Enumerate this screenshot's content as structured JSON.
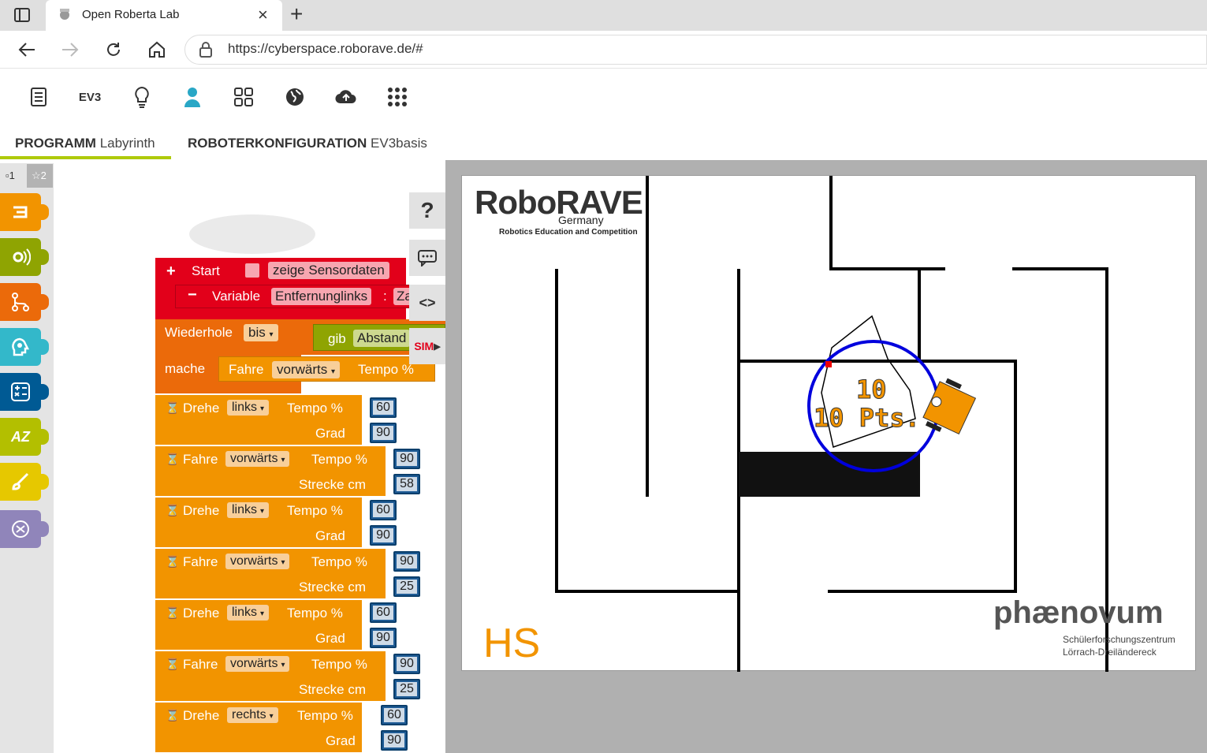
{
  "browser": {
    "tab_title": "Open Roberta Lab",
    "url": "https://cyberspace.roborave.de/#",
    "new_tab_symbol": "+",
    "close_symbol": "×"
  },
  "menubar": {
    "items": [
      "list-icon",
      "EV3",
      "lightbulb-icon",
      "user-icon",
      "gallery-icon",
      "globe-icon",
      "cloud-icon",
      "apps-icon"
    ],
    "ev3_label": "EV3"
  },
  "tabs": {
    "program_label": "PROGRAMM",
    "program_name": "Labyrinth",
    "config_label": "ROBOTERKONFIGURATION",
    "config_name": "EV3basis"
  },
  "toolbox": {
    "level1": "1",
    "level2": "2",
    "categories": [
      {
        "name": "action",
        "color": "#f29400"
      },
      {
        "name": "sensors",
        "color": "#8fa402"
      },
      {
        "name": "control",
        "color": "#eb6a0a"
      },
      {
        "name": "logic",
        "color": "#33b8ca"
      },
      {
        "name": "math",
        "color": "#005a94"
      },
      {
        "name": "text",
        "color": "#b3bf00"
      },
      {
        "name": "colour",
        "color": "#e6c800"
      },
      {
        "name": "variables",
        "color": "#9085ba"
      }
    ]
  },
  "program": {
    "start_label": "Start",
    "show_sensor_label": "zeige Sensordaten",
    "variable_label": "Variable",
    "variable_name": "Entfernunglinks",
    "variable_colon": ":",
    "variable_type_partial": "Za",
    "repeat_label": "Wiederhole",
    "repeat_mode": "bis",
    "get_label": "gib",
    "get_value": "Abstand",
    "do_label": "mache",
    "drive_label": "Fahre",
    "drive_dir": "vorwärts",
    "speed_label": "Tempo %",
    "turn_label": "Drehe",
    "degree_label": "Grad",
    "distance_label": "Strecke cm",
    "steps": [
      {
        "action": "Drehe",
        "dir": "links",
        "speed": "60",
        "param_label": "Grad",
        "param": "90"
      },
      {
        "action": "Fahre",
        "dir": "vorwärts",
        "speed": "90",
        "param_label": "Strecke cm",
        "param": "58"
      },
      {
        "action": "Drehe",
        "dir": "links",
        "speed": "60",
        "param_label": "Grad",
        "param": "90"
      },
      {
        "action": "Fahre",
        "dir": "vorwärts",
        "speed": "90",
        "param_label": "Strecke cm",
        "param": "25"
      },
      {
        "action": "Drehe",
        "dir": "links",
        "speed": "60",
        "param_label": "Grad",
        "param": "90"
      },
      {
        "action": "Fahre",
        "dir": "vorwärts",
        "speed": "90",
        "param_label": "Strecke cm",
        "param": "25"
      },
      {
        "action": "Drehe",
        "dir": "rechts",
        "speed": "60",
        "param_label": "Grad",
        "param": "90"
      }
    ]
  },
  "side_buttons": {
    "help": "?",
    "code": "<>",
    "sim": "SIM"
  },
  "simulation": {
    "logo_main": "RoboRAVE",
    "logo_sub": "Germany",
    "logo_tagline": "Robotics Education and Competition",
    "score_line1": "10",
    "score_line2": "10 Pts.",
    "corner_mark": "HS",
    "sponsor_name": "phænovum",
    "sponsor_line1": "Schülerforschungszentrum",
    "sponsor_line2": "Lörrach-Dreiländereck"
  }
}
